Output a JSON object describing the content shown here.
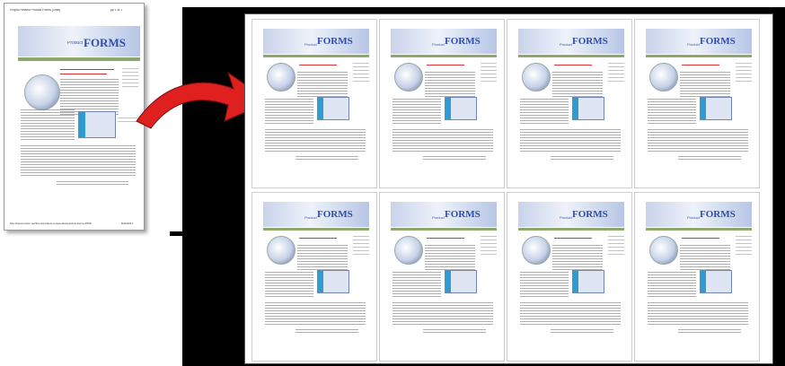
{
  "source_page": {
    "header_left": "Project Review Product Forms (Total)",
    "header_right": "pp 1 of 1",
    "banner_title": "FORMS",
    "banner_prefix": "Product",
    "footer_url": "http://www.macro.net/forms/product-review-tiles/product-forms-2PDF",
    "footer_date": "8/10/2017"
  },
  "thumbnail": {
    "banner_prefix": "Product",
    "banner_title": "FORMS"
  },
  "layout": {
    "tiles": 8,
    "rows": 2,
    "columns": 4
  },
  "colors": {
    "arrow": "#e01f1f",
    "panel": "#000000",
    "banner_title": "#2f4fa8",
    "nav_bar": "#8ea86b"
  }
}
